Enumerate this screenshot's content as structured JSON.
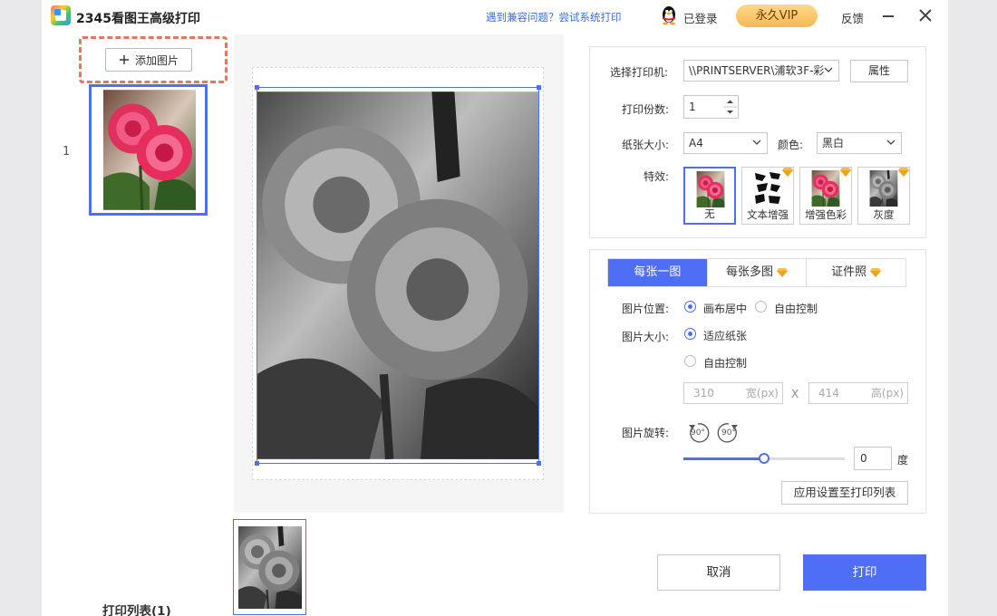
{
  "app": {
    "title": "2345看图王高级打印",
    "compat_link": "遇到兼容问题？尝试系统打印",
    "login_status": "已登录",
    "vip_label": "永久VIP",
    "feedback_label": "反馈"
  },
  "left": {
    "add_button": "添加图片",
    "thumb_index": "1",
    "print_list_label": "打印列表(1)"
  },
  "settings": {
    "printer_label": "选择打印机:",
    "printer_value": "\\\\PRINTSERVER\\浦软3F-彩",
    "properties_button": "属性",
    "copies_label": "打印份数:",
    "copies_value": "1",
    "paper_label": "纸张大小:",
    "paper_value": "A4",
    "color_label": "颜色:",
    "color_value": "黑白",
    "effects_label": "特效:",
    "effects": [
      {
        "label": "无",
        "selected": true,
        "premium": false
      },
      {
        "label": "文本增强",
        "selected": false,
        "premium": true
      },
      {
        "label": "增强色彩",
        "selected": false,
        "premium": true
      },
      {
        "label": "灰度",
        "selected": false,
        "premium": true
      }
    ]
  },
  "layout": {
    "tabs": [
      {
        "label": "每张一图",
        "active": true,
        "premium": false
      },
      {
        "label": "每张多图",
        "active": false,
        "premium": true
      },
      {
        "label": "证件照",
        "active": false,
        "premium": true
      }
    ],
    "position_label": "图片位置:",
    "position_options": [
      "画布居中",
      "自由控制"
    ],
    "position_selected": "画布居中",
    "size_label": "图片大小:",
    "size_options": [
      "适应纸张",
      "自由控制"
    ],
    "size_selected": "适应纸张",
    "width_value": "310",
    "width_unit": "宽(px)",
    "height_value": "414",
    "height_unit": "高(px)",
    "dim_separator": "X",
    "rotate_label": "图片旋转:",
    "rotate_left_label": "90°",
    "rotate_right_label": "90°",
    "rotation_slider_fraction": 0.5,
    "degree_value": "0",
    "degree_unit": "度",
    "apply_button": "应用设置至打印列表"
  },
  "footer": {
    "cancel_button": "取消",
    "print_button": "打印"
  },
  "colors": {
    "accent": "#4f6ef6",
    "vip_gold": "#f7b853",
    "dashed_highlight": "#e07a5f"
  }
}
